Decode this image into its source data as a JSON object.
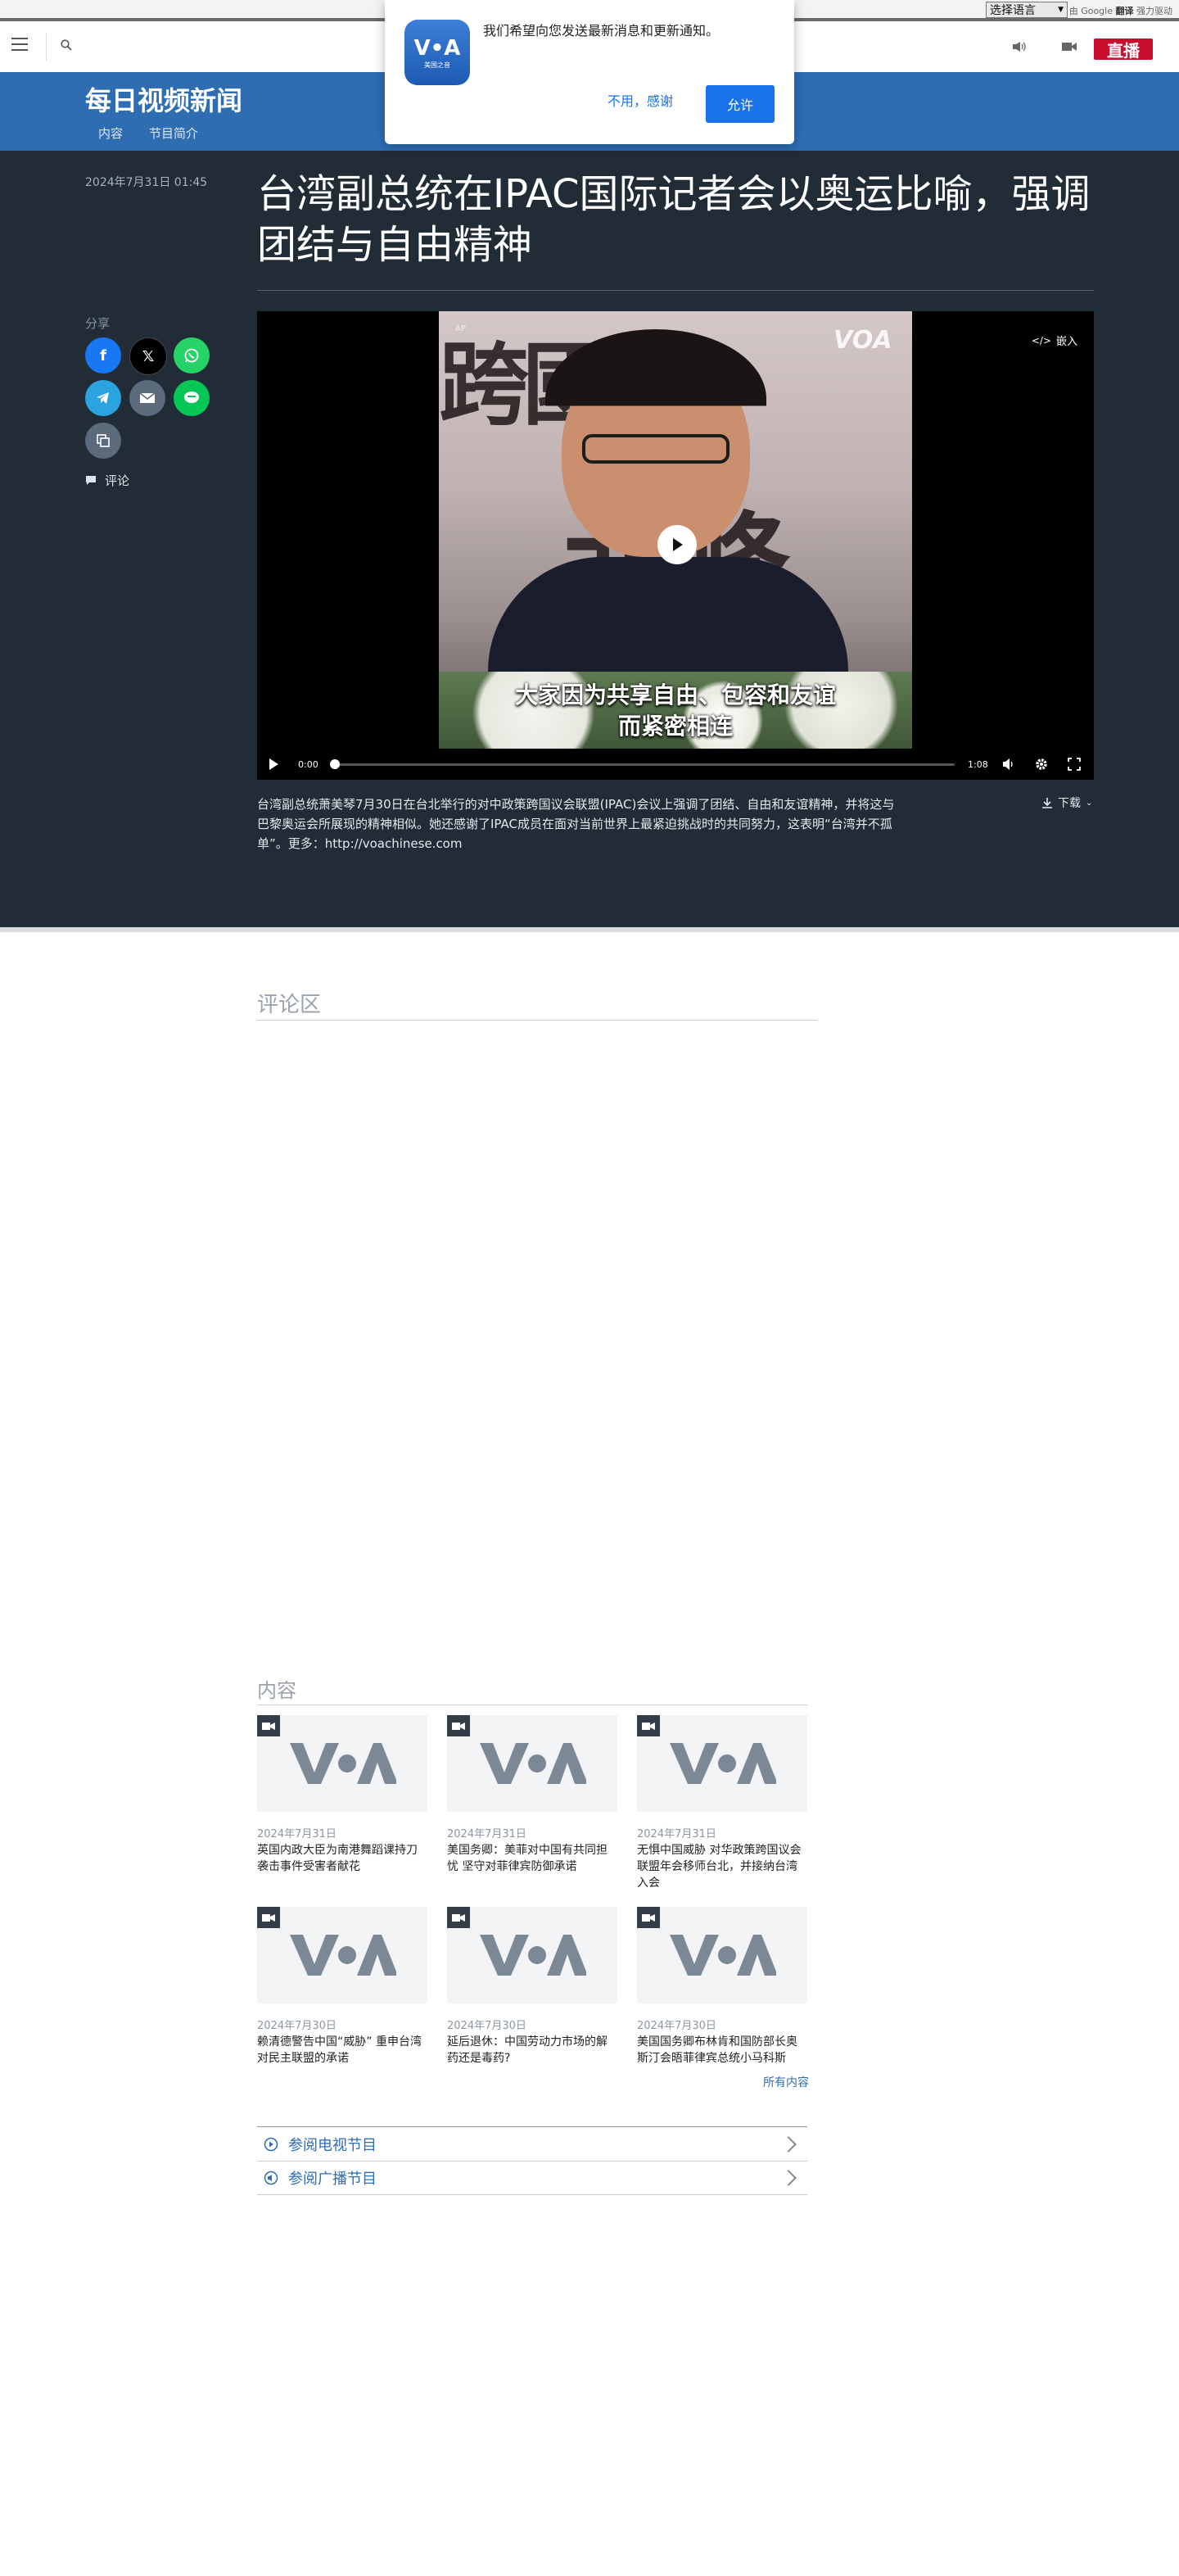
{
  "translate_bar": {
    "select_label": "选择语言",
    "powered_prefix": "由",
    "google": "Google",
    "translate": "翻译",
    "powered_suffix": "强力驱动"
  },
  "header": {
    "live_label": "直播"
  },
  "program": {
    "title": "每日视频新闻",
    "nav": [
      "内容",
      "节目简介"
    ]
  },
  "article": {
    "date": "2024年7月31日 01:45",
    "headline": "台湾副总统在IPAC国际记者会以奥运比喻，强调团结与自由精神",
    "share_label": "分享",
    "comment_label": "评论",
    "caption": "台湾副总统萧美琴7月30日在台北举行的对中政策跨国议会联盟(IPAC)会议上强调了团结、自由和友谊精神，并将这与巴黎奥运会所展现的精神相似。她还感谢了IPAC成员在面对当前世界上最紧迫挑战时的共同努力，这表明“台湾并不孤单”。更多：http://voachinese.com",
    "download_label": "下载"
  },
  "video": {
    "bg_text_top": "跨國議",
    "bg_text_bottom": "北峰",
    "watermark": "VOA",
    "source_mark": "AP",
    "subtitle_line1": "大家因为共享自由、包容和友谊",
    "subtitle_line2": "而紧密相连",
    "embed_label": "嵌入",
    "current_time": "0:00",
    "duration": "1:08",
    "progress": 0
  },
  "comments": {
    "title": "评论区"
  },
  "related": {
    "title": "内容",
    "items": [
      {
        "date": "2024年7月31日",
        "title": "英国内政大臣为南港舞蹈课持刀袭击事件受害者献花"
      },
      {
        "date": "2024年7月31日",
        "title": "美国务卿：美菲对中国有共同担忧 坚守对菲律宾防御承诺"
      },
      {
        "date": "2024年7月31日",
        "title": "无惧中国威胁 对华政策跨国议会联盟年会移师台北，并接纳台湾入会"
      },
      {
        "date": "2024年7月30日",
        "title": "赖清德警告中国“威胁” 重申台湾对民主联盟的承诺"
      },
      {
        "date": "2024年7月30日",
        "title": "延后退休：中国劳动力市场的解药还是毒药?"
      },
      {
        "date": "2024年7月30日",
        "title": "美国国务卿布林肯和国防部长奥斯汀会晤菲律宾总统小马科斯"
      }
    ],
    "all_link": "所有内容",
    "tv_link": "参阅电视节目",
    "radio_link": "参阅广播节目"
  },
  "popup": {
    "icon_text": "V•A",
    "icon_sub": "美国之音",
    "message": "我们希望向您发送最新消息和更新通知。",
    "deny_label": "不用，感谢",
    "allow_label": "允许"
  },
  "colors": {
    "brand_blue": "#2f6db3",
    "dark_bg": "#212c37",
    "live_red": "#c8102e",
    "facebook": "#1877f2",
    "x": "#000000",
    "whatsapp": "#25d366",
    "telegram": "#2aa3df",
    "email": "#5b6b7b",
    "line": "#06c755",
    "copy": "#5b6b7b"
  }
}
